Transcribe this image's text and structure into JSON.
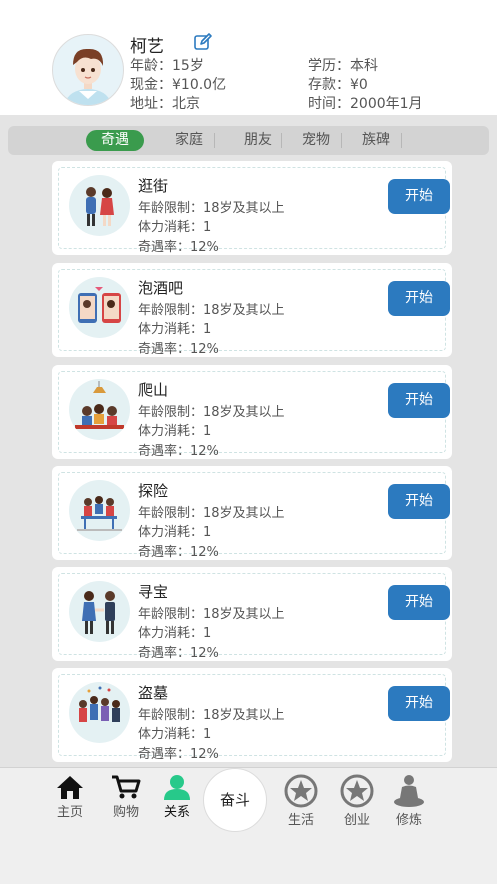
{
  "profile": {
    "name": "柯艺",
    "age": "年龄：15岁",
    "cash": "现金：¥10.0亿",
    "address": "地址：北京",
    "education": "学历：本科",
    "deposit": "存款：¥0",
    "time": "时间：2000年1月"
  },
  "tabs": [
    "奇遇",
    "家庭",
    "朋友",
    "宠物",
    "族碑"
  ],
  "active_tab": "奇遇",
  "cards": [
    {
      "title": "逛街",
      "age_limit": "年龄限制：18岁及其以上",
      "stamina": "体力消耗：1",
      "rate": "奇遇率：12%",
      "button": "开始",
      "icon": "couple-icon"
    },
    {
      "title": "泡酒吧",
      "age_limit": "年龄限制：18岁及其以上",
      "stamina": "体力消耗：1",
      "rate": "奇遇率：12%",
      "button": "开始",
      "icon": "phone-chat-icon"
    },
    {
      "title": "爬山",
      "age_limit": "年龄限制：18岁及其以上",
      "stamina": "体力消耗：1",
      "rate": "奇遇率：12%",
      "button": "开始",
      "icon": "dinner-icon"
    },
    {
      "title": "探险",
      "age_limit": "年龄限制：18岁及其以上",
      "stamina": "体力消耗：1",
      "rate": "奇遇率：12%",
      "button": "开始",
      "icon": "meeting-icon"
    },
    {
      "title": "寻宝",
      "age_limit": "年龄限制：18岁及其以上",
      "stamina": "体力消耗：1",
      "rate": "奇遇率：12%",
      "button": "开始",
      "icon": "handshake-icon"
    },
    {
      "title": "盗墓",
      "age_limit": "年龄限制：18岁及其以上",
      "stamina": "体力消耗：1",
      "rate": "奇遇率：12%",
      "button": "开始",
      "icon": "party-icon"
    }
  ],
  "nav": {
    "home": "主页",
    "shop": "购物",
    "relations": "关系",
    "center": "奋斗",
    "life": "生活",
    "business": "创业",
    "cultivate": "修炼"
  },
  "colors": {
    "accent_green": "#3a9b4d",
    "button_blue": "#2c7abf",
    "active_nav": "#27c98a"
  }
}
